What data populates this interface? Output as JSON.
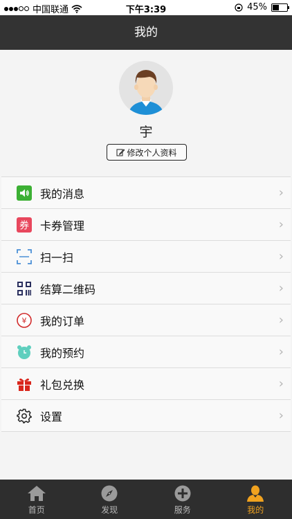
{
  "status_bar": {
    "carrier": "中国联通",
    "time": "下午3:39",
    "battery": "45%",
    "battery_level": 0.45
  },
  "nav": {
    "title": "我的"
  },
  "profile": {
    "name": "宇",
    "edit_label": "修改个人资料"
  },
  "menu": [
    {
      "label": "我的消息",
      "icon": "speaker-icon",
      "color": "#3cb034"
    },
    {
      "label": "卡券管理",
      "icon": "coupon-icon",
      "color": "#e8475d"
    },
    {
      "label": "扫一扫",
      "icon": "scan-icon",
      "color": "#4a8fd6"
    },
    {
      "label": "结算二维码",
      "icon": "qrcode-icon",
      "color": "#2a2f5e"
    },
    {
      "label": "我的订单",
      "icon": "yen-icon",
      "color": "#d12a2a"
    },
    {
      "label": "我的预约",
      "icon": "alarm-clock-icon",
      "color": "#5fcfbe"
    },
    {
      "label": "礼包兑换",
      "icon": "gift-icon",
      "color": "#d9261c"
    },
    {
      "label": "设置",
      "icon": "gear-icon",
      "color": "#222222"
    }
  ],
  "tabs": [
    {
      "label": "首页",
      "icon": "home-icon",
      "active": false
    },
    {
      "label": "发现",
      "icon": "compass-icon",
      "active": false
    },
    {
      "label": "服务",
      "icon": "plus-circle-icon",
      "active": false
    },
    {
      "label": "我的",
      "icon": "person-icon",
      "active": true
    }
  ],
  "colors": {
    "nav_bg": "#333333",
    "tab_bg": "#2e2e2e",
    "accent": "#f0a21f"
  }
}
